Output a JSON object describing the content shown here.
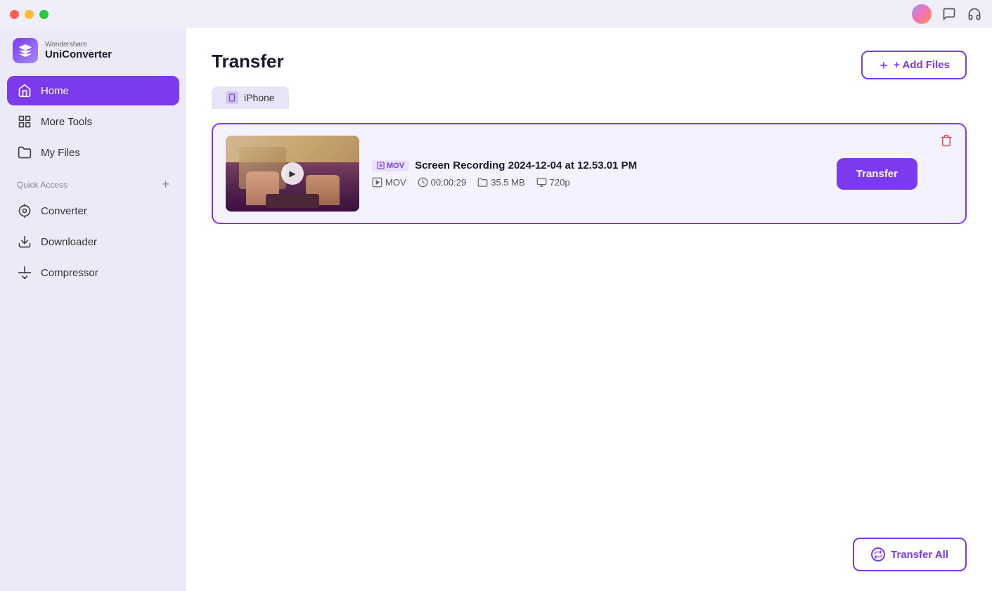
{
  "titlebar": {
    "traffic_lights": [
      "red",
      "yellow",
      "green"
    ]
  },
  "sidebar": {
    "logo": {
      "brand": "Wondershare",
      "name": "UniConverter",
      "icon_char": "U"
    },
    "nav_items": [
      {
        "id": "home",
        "label": "Home",
        "active": true
      },
      {
        "id": "more-tools",
        "label": "More Tools",
        "active": false
      },
      {
        "id": "my-files",
        "label": "My Files",
        "active": false
      }
    ],
    "quick_access_label": "Quick Access",
    "quick_access_items": [
      {
        "id": "converter",
        "label": "Converter"
      },
      {
        "id": "downloader",
        "label": "Downloader"
      },
      {
        "id": "compressor",
        "label": "Compressor"
      }
    ]
  },
  "main": {
    "page_title": "Transfer",
    "device_tab": {
      "label": "iPhone"
    },
    "add_files_label": "+ Add Files",
    "files": [
      {
        "id": "file-1",
        "name": "Screen Recording 2024-12-04 at 12.53.01 PM",
        "format": "MOV",
        "duration": "00:00:29",
        "size": "35.5 MB",
        "resolution": "720p"
      }
    ],
    "transfer_button_label": "Transfer",
    "transfer_all_label": "Transfer All"
  }
}
